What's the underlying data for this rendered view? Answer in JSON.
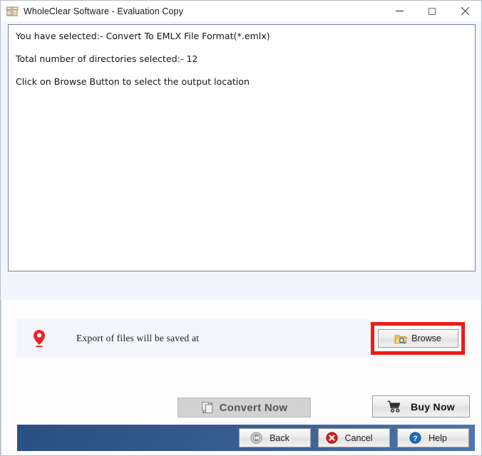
{
  "window": {
    "title": "WholeClear Software - Evaluation Copy",
    "app_icon": "archive-box-icon",
    "controls": {
      "minimize": "minimize-icon",
      "maximize": "maximize-icon",
      "close": "close-icon"
    }
  },
  "log": {
    "lines": [
      "You have selected:- Convert To EMLX File Format(*.emlx)",
      "Total number of directories selected:- 12",
      "Click on Browse Button to select the output location"
    ],
    "selected_format": "EMLX File Format(*.emlx)",
    "directories_selected": 12
  },
  "save_row": {
    "icon": "location-pin-icon",
    "label": "Export of files will be saved at",
    "path_value": ""
  },
  "browse": {
    "label": "Browse",
    "icon": "folder-search-icon",
    "highlight_color": "#ee1b1b"
  },
  "actions": {
    "convert": {
      "label": "Convert Now",
      "icon": "convert-pages-icon",
      "enabled": false
    },
    "buy": {
      "label": "Buy Now",
      "icon": "shopping-cart-icon",
      "enabled": true
    }
  },
  "footer": {
    "bar_color": "#35598c",
    "buttons": [
      {
        "label": "Back",
        "icon": "rewind-icon"
      },
      {
        "label": "Cancel",
        "icon": "cancel-icon"
      },
      {
        "label": "Help",
        "icon": "help-icon"
      }
    ]
  }
}
